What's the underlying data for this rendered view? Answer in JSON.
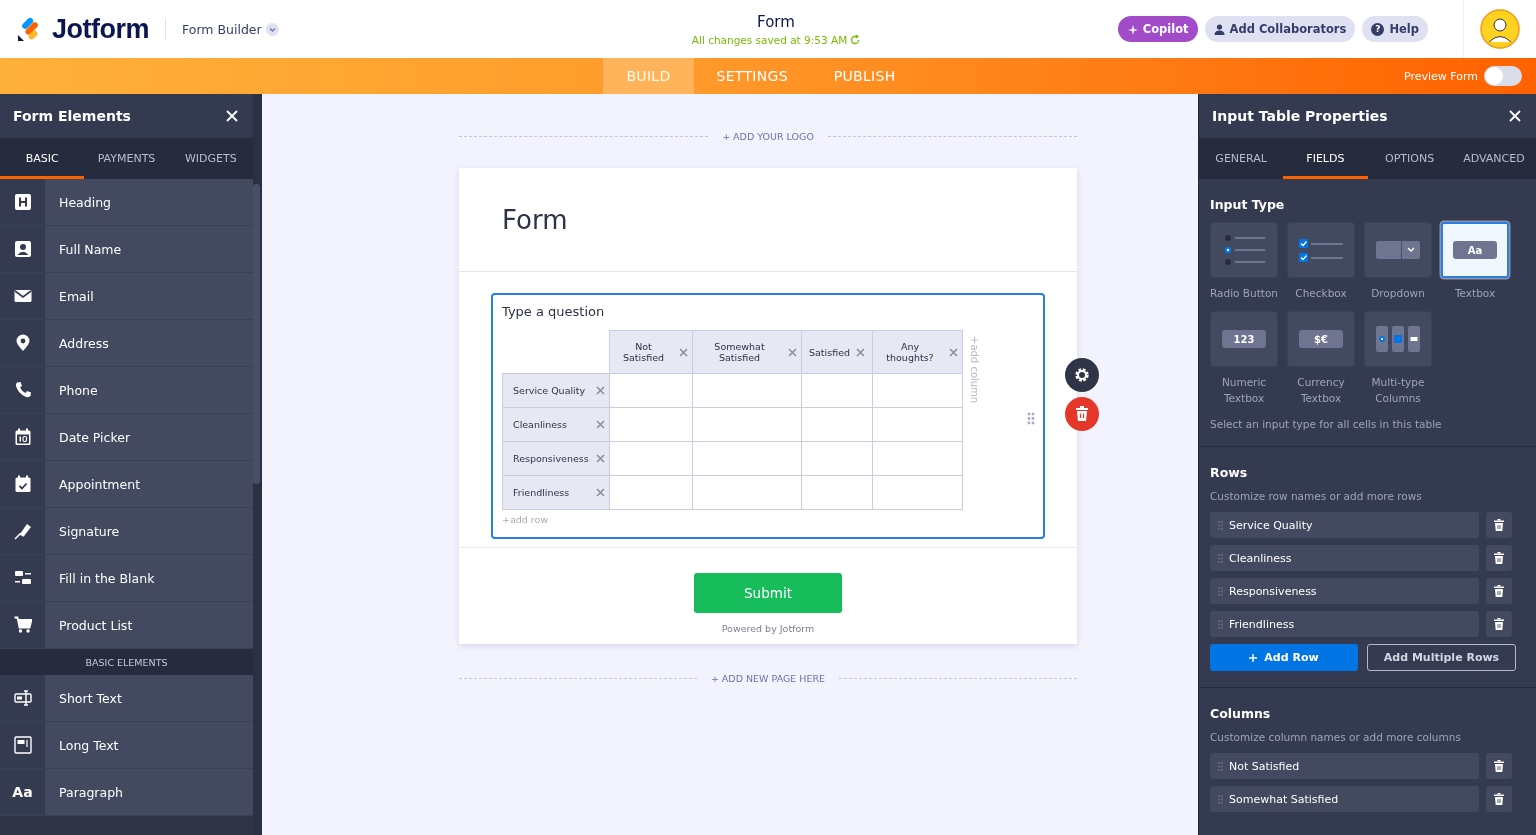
{
  "header": {
    "logo": "Jotform",
    "product": "Form Builder",
    "title": "Form",
    "save_status": "All changes saved at 9:53 AM",
    "buttons": [
      {
        "kind": "copilot",
        "label": "Copilot"
      },
      {
        "kind": "collab",
        "label": "Add Collaborators"
      },
      {
        "kind": "help",
        "label": "Help",
        "glyph": "?"
      }
    ]
  },
  "nav": {
    "tabs": [
      {
        "label": "BUILD",
        "selected": true
      },
      {
        "label": "SETTINGS",
        "selected": false
      },
      {
        "label": "PUBLISH",
        "selected": false
      }
    ],
    "preview": {
      "label": "Preview Form",
      "on": false
    }
  },
  "left_panel": {
    "title": "Form Elements",
    "tabs": [
      {
        "label": "BASIC",
        "selected": true
      },
      {
        "label": "PAYMENTS",
        "selected": false
      },
      {
        "label": "WIDGETS",
        "selected": false
      }
    ],
    "items": [
      {
        "kind": "element",
        "label": "Heading"
      },
      {
        "kind": "element",
        "label": "Full Name"
      },
      {
        "kind": "element",
        "label": "Email"
      },
      {
        "kind": "element",
        "label": "Address"
      },
      {
        "kind": "element",
        "label": "Phone"
      },
      {
        "kind": "element",
        "label": "Date Picker"
      },
      {
        "kind": "element",
        "label": "Appointment"
      },
      {
        "kind": "element",
        "label": "Signature"
      },
      {
        "kind": "element",
        "label": "Fill in the Blank"
      },
      {
        "kind": "element",
        "label": "Product List"
      },
      {
        "kind": "section",
        "label": "BASIC ELEMENTS"
      },
      {
        "kind": "element",
        "label": "Short Text"
      },
      {
        "kind": "element",
        "label": "Long Text"
      },
      {
        "kind": "element",
        "label": "Paragraph",
        "glyph": "Aa"
      }
    ]
  },
  "canvas": {
    "add_logo": "+ ADD YOUR LOGO",
    "form_title": "Form",
    "question": "Type a question",
    "columns": [
      "Not Satisfied",
      "Somewhat Satisfied",
      "Satisfied",
      "Any thoughts?"
    ],
    "rows": [
      "Service Quality",
      "Cleanliness",
      "Responsiveness",
      "Friendliness"
    ],
    "add_row": "+add row",
    "add_column": "+add column",
    "submit": "Submit",
    "powered_by": "Powered by Jotform",
    "add_page": "+ ADD NEW PAGE HERE"
  },
  "right_panel": {
    "title": "Input Table Properties",
    "tabs": [
      {
        "label": "GENERAL",
        "selected": false
      },
      {
        "label": "FIELDS",
        "selected": true
      },
      {
        "label": "OPTIONS",
        "selected": false
      },
      {
        "label": "ADVANCED",
        "selected": false
      }
    ],
    "input_type": {
      "heading": "Input Type",
      "types": [
        {
          "label": "Radio Button",
          "selected": false
        },
        {
          "label": "Checkbox",
          "selected": false
        },
        {
          "label": "Dropdown",
          "selected": false
        },
        {
          "label": "Textbox",
          "selected": true,
          "glyph": "Aa"
        },
        {
          "label": "Numeric Textbox",
          "selected": false,
          "glyph": "123"
        },
        {
          "label": "Currency Textbox",
          "selected": false,
          "glyph": "$€"
        },
        {
          "label": "Multi-type Columns",
          "selected": false
        }
      ],
      "hint": "Select an input type for all cells in this table"
    },
    "rows": {
      "heading": "Rows",
      "hint": "Customize row names or add more rows",
      "items": [
        "Service Quality",
        "Cleanliness",
        "Responsiveness",
        "Friendliness"
      ],
      "add_button": "Add Row",
      "multi_button": "Add Multiple Rows"
    },
    "columns": {
      "heading": "Columns",
      "hint": "Customize column names or add more columns",
      "items": [
        "Not Satisfied",
        "Somewhat Satisfied"
      ]
    }
  }
}
